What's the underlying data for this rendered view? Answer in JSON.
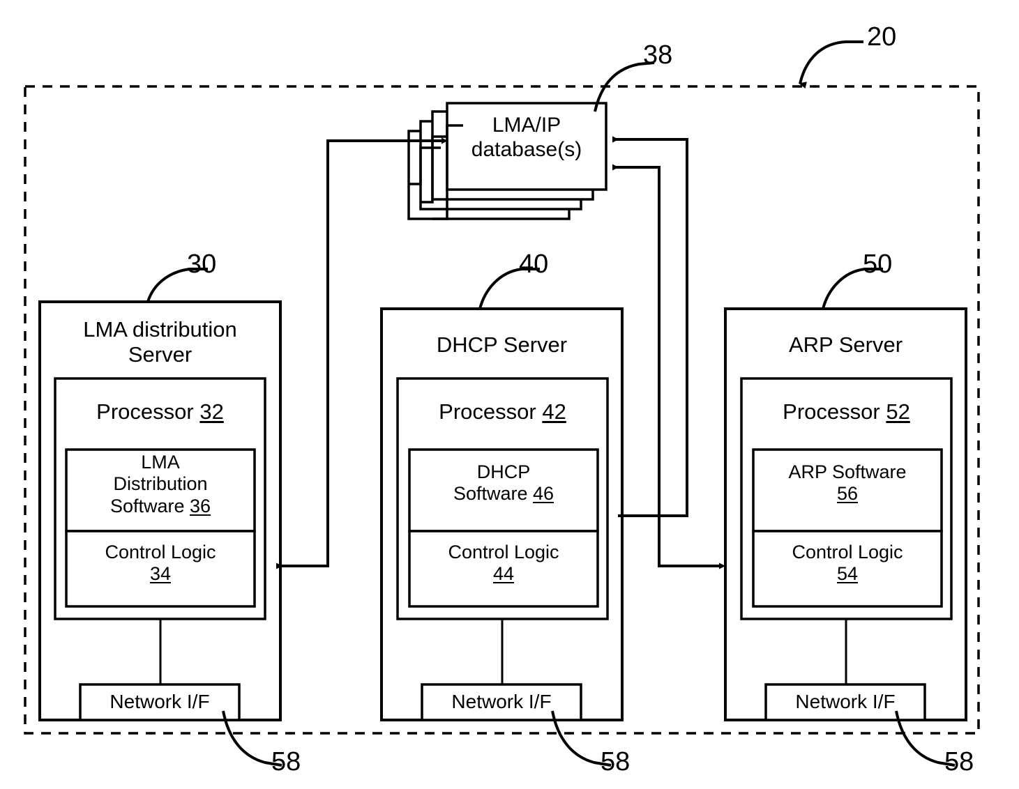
{
  "figure": {
    "system_ref": "20",
    "boundary_style": "dashed"
  },
  "database": {
    "label": "LMA/IP\ndatabase(s)",
    "ref": "38",
    "stack_count": 4
  },
  "servers": [
    {
      "id": "lma-distribution-server",
      "title": "LMA distribution\nServer",
      "ref": "30",
      "processor": {
        "label": "Processor",
        "ref": "32"
      },
      "software": {
        "label": "LMA\nDistribution\nSoftware",
        "ref": "36"
      },
      "control": {
        "label": "Control Logic",
        "ref": "34"
      },
      "network_if": {
        "label": "Network I/F",
        "ref": "58"
      }
    },
    {
      "id": "dhcp-server",
      "title": "DHCP Server",
      "ref": "40",
      "processor": {
        "label": "Processor",
        "ref": "42"
      },
      "software": {
        "label": "DHCP\nSoftware",
        "ref": "46"
      },
      "control": {
        "label": "Control Logic",
        "ref": "44"
      },
      "network_if": {
        "label": "Network I/F",
        "ref": "58"
      }
    },
    {
      "id": "arp-server",
      "title": "ARP Server",
      "ref": "50",
      "processor": {
        "label": "Processor",
        "ref": "52"
      },
      "software": {
        "label": "ARP Software",
        "ref": "56"
      },
      "control": {
        "label": "Control Logic",
        "ref": "54"
      },
      "network_if": {
        "label": "Network I/F",
        "ref": "58"
      }
    }
  ],
  "colors": {
    "stroke": "#000000",
    "background": "#ffffff"
  }
}
